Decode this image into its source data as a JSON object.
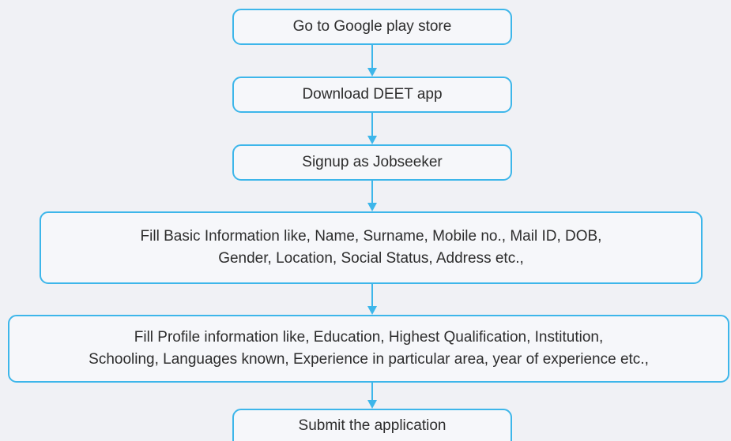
{
  "flow": {
    "colors": {
      "border": "#3db6ea",
      "arrow": "#3db6ea",
      "background": "#f0f1f5",
      "text": "#2d2d2d"
    },
    "steps": [
      {
        "lines": [
          "Go to Google play store"
        ]
      },
      {
        "lines": [
          "Download DEET app"
        ]
      },
      {
        "lines": [
          "Signup as Jobseeker"
        ]
      },
      {
        "lines": [
          "Fill Basic Information like, Name, Surname, Mobile no., Mail ID, DOB,",
          "Gender, Location, Social Status, Address etc.,"
        ]
      },
      {
        "lines": [
          "Fill Profile information like, Education, Highest Qualification, Institution,",
          "Schooling, Languages known, Experience in particular area, year of experience etc.,"
        ]
      },
      {
        "lines": [
          "Submit the application"
        ]
      }
    ]
  }
}
